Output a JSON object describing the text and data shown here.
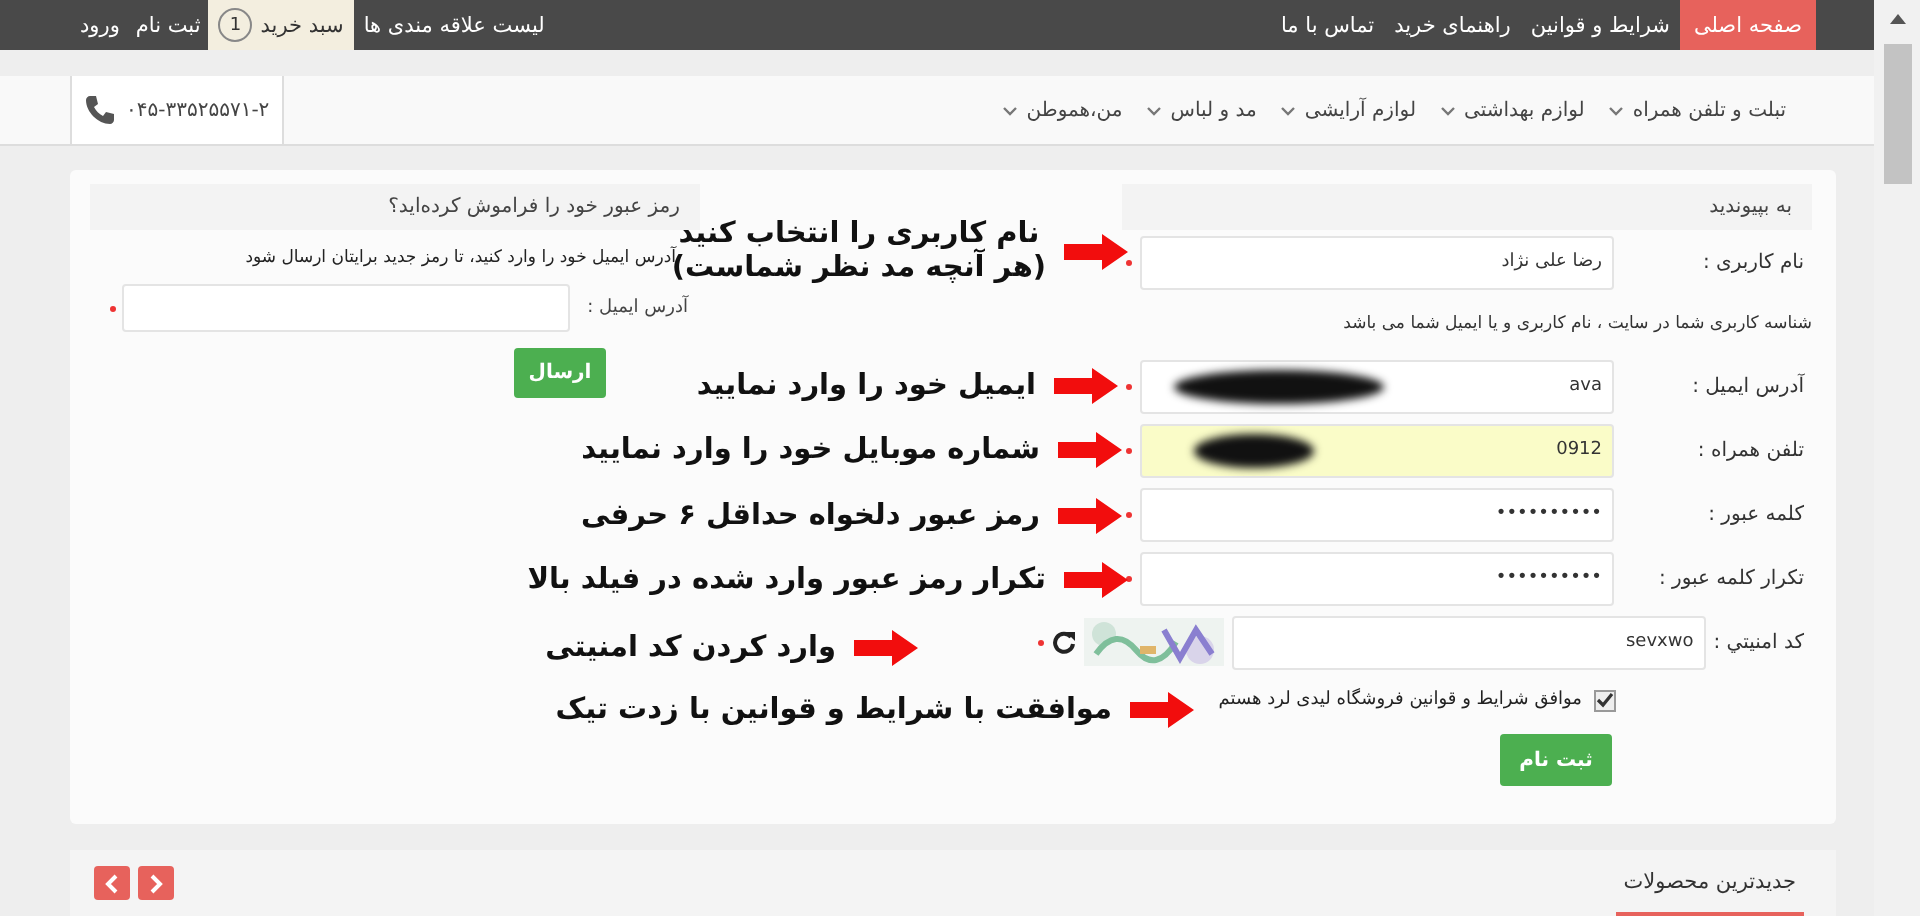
{
  "top_bar": {
    "menu": [
      {
        "label": "صفحه اصلی",
        "selected": true
      },
      {
        "label": "شرایط و قوانین",
        "selected": false
      },
      {
        "label": "راهنمای خرید",
        "selected": false
      },
      {
        "label": "تماس با ما",
        "selected": false
      }
    ],
    "wishlist": "لیست علاقه مندی ها",
    "cart": {
      "label": "سبد خرید",
      "count": "1"
    },
    "account_links": [
      "ثبت نام",
      "ورود"
    ]
  },
  "nav": {
    "items": [
      "تبلت و تلفن همراه",
      "لوازم بهداشتی",
      "لوازم آرایشی",
      "مد و لباس",
      "من،هموطن"
    ],
    "phone": "۰۴۵-۳۳۵۲۵۵۷۱-۲"
  },
  "register": {
    "title": "به بپیوندید",
    "rows": [
      {
        "kind": "input",
        "label": "نام کاربری :",
        "value": "رضا علی نژاد",
        "required": true
      },
      {
        "kind": "hint",
        "text": "شناسه کاربری شما در سایت ، نام کاربری و یا ایمیل شما می باشد"
      },
      {
        "kind": "input",
        "label": "آدرس ایمیل :",
        "value": "ava",
        "required": true,
        "redacted": true
      },
      {
        "kind": "input",
        "label": "تلفن همراه :",
        "value": "0912",
        "required": true,
        "redacted": true,
        "highlighted": true
      },
      {
        "kind": "input",
        "label": "کلمه عبور :",
        "value": "••••••••••",
        "required": true
      },
      {
        "kind": "input",
        "label": "تکرار کلمه عبور :",
        "value": "••••••••••",
        "required": true
      },
      {
        "kind": "captcha",
        "label": "کد امنیتي :",
        "value": "sevxwo",
        "required": true
      },
      {
        "kind": "checkbox",
        "label": "موافق شرایط و قوانین فروشگاه لیدی لرد هستم",
        "checked": true
      }
    ],
    "submit": "ثبت نام"
  },
  "forgot_password": {
    "title": "رمز عبور خود را فراموش کرده‌اید؟",
    "text": "آدرس ایمیل خود را وارد کنید، تا رمز جدید برایتان ارسال شود",
    "field_label": "آدرس ایمیل :",
    "required": true,
    "button": "ارسال"
  },
  "annotations": [
    "نام کاربری را انتخاب کنید\n(هر آنچه مد نظر شماست)",
    "ایمیل خود را وارد نمایید",
    "شماره موبایل خود را وارد نمایید",
    "رمز عبور دلخواه حداقل ۶ حرفی",
    "تکرار رمز عبور وارد شده در فیلد بالا",
    "وارد کردن کد امنیتی",
    "موافقت با شرایط و قوانین با زدت تیک"
  ],
  "section": {
    "title": "جدیدترین محصولات"
  }
}
